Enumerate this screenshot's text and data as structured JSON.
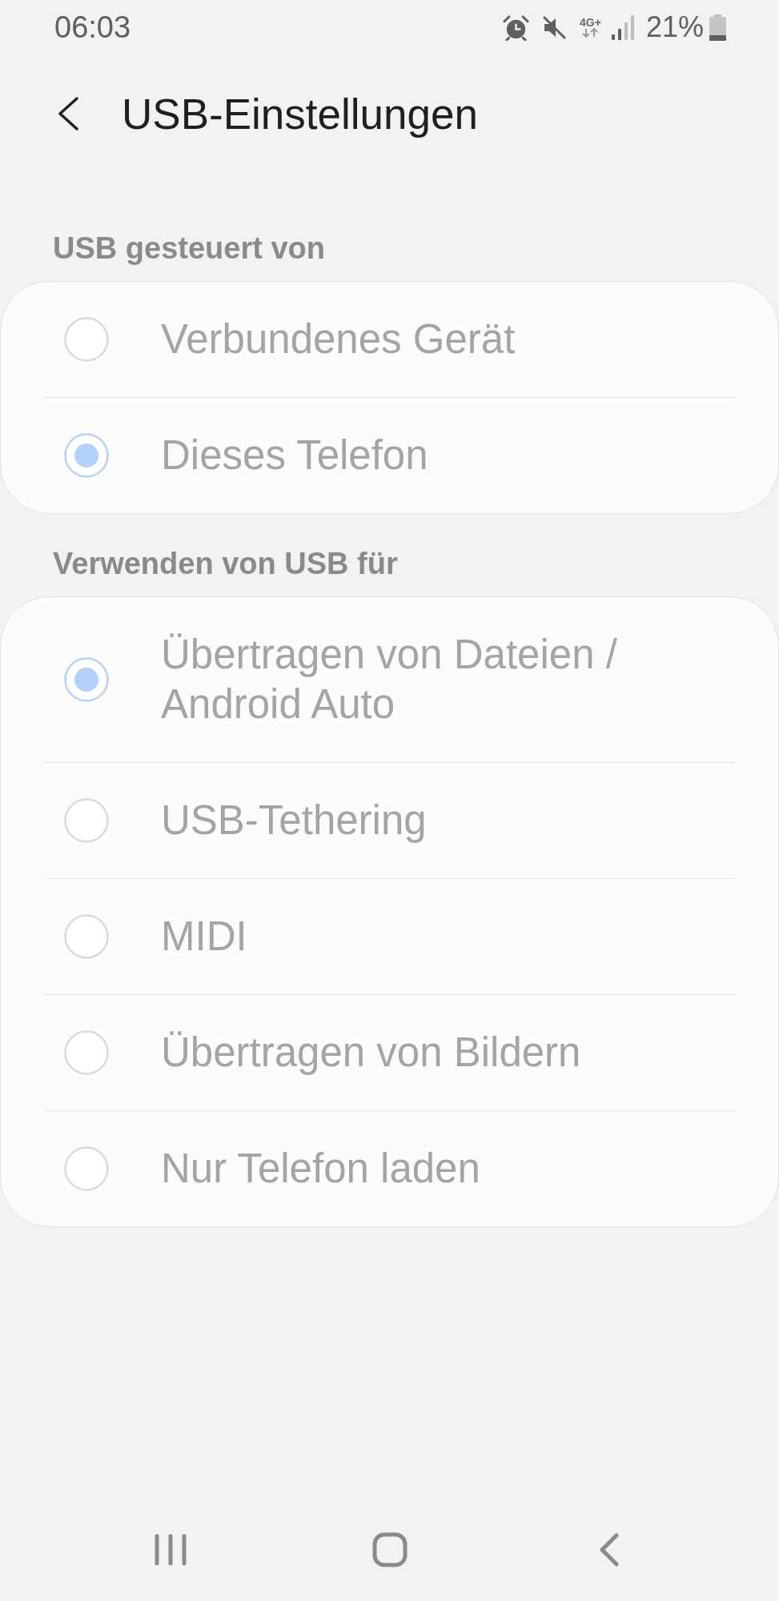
{
  "status_bar": {
    "time": "06:03",
    "network_type": "4G+",
    "battery_percent": "21%"
  },
  "header": {
    "title": "USB-Einstellungen"
  },
  "sections": [
    {
      "title": "USB gesteuert von",
      "options": [
        {
          "label": "Verbundenes Gerät",
          "selected": false,
          "disabled": true
        },
        {
          "label": "Dieses Telefon",
          "selected": true,
          "disabled": true
        }
      ]
    },
    {
      "title": "Verwenden von USB für",
      "options": [
        {
          "label": "Übertragen von Dateien / Android Auto",
          "selected": true,
          "disabled": true
        },
        {
          "label": "USB-Tethering",
          "selected": false,
          "disabled": true
        },
        {
          "label": "MIDI",
          "selected": false,
          "disabled": true
        },
        {
          "label": "Übertragen von Bildern",
          "selected": false,
          "disabled": true
        },
        {
          "label": "Nur Telefon laden",
          "selected": false,
          "disabled": true
        }
      ]
    }
  ]
}
